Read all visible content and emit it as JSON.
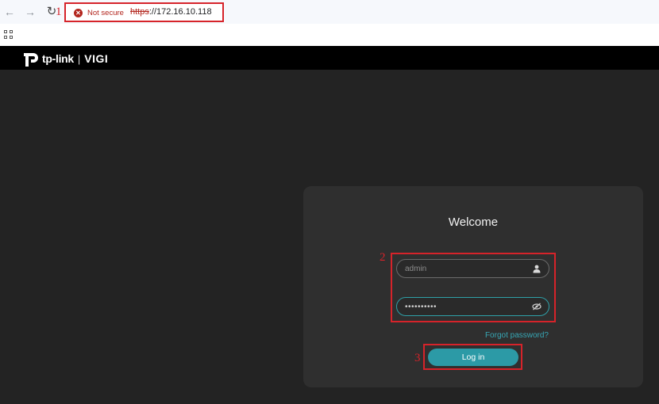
{
  "browser": {
    "back_icon": "arrow-left-icon",
    "forward_icon": "arrow-right-icon",
    "reload_icon": "reload-icon",
    "security_status": "Not secure",
    "url_scheme": "https",
    "url_rest": "://172.16.10.118",
    "apps_icon": "grid-icon"
  },
  "header": {
    "brand": "tp-link",
    "separator": "|",
    "product": "VIGI"
  },
  "login": {
    "title": "Welcome",
    "username_placeholder": "admin",
    "password_value": "••••••••••",
    "forgot_password": "Forgot password?",
    "login_button": "Log in",
    "accent_color": "#2c9aa6"
  },
  "annotations": {
    "step1": "1",
    "step2": "2",
    "step3": "3",
    "color": "#d6232a"
  }
}
